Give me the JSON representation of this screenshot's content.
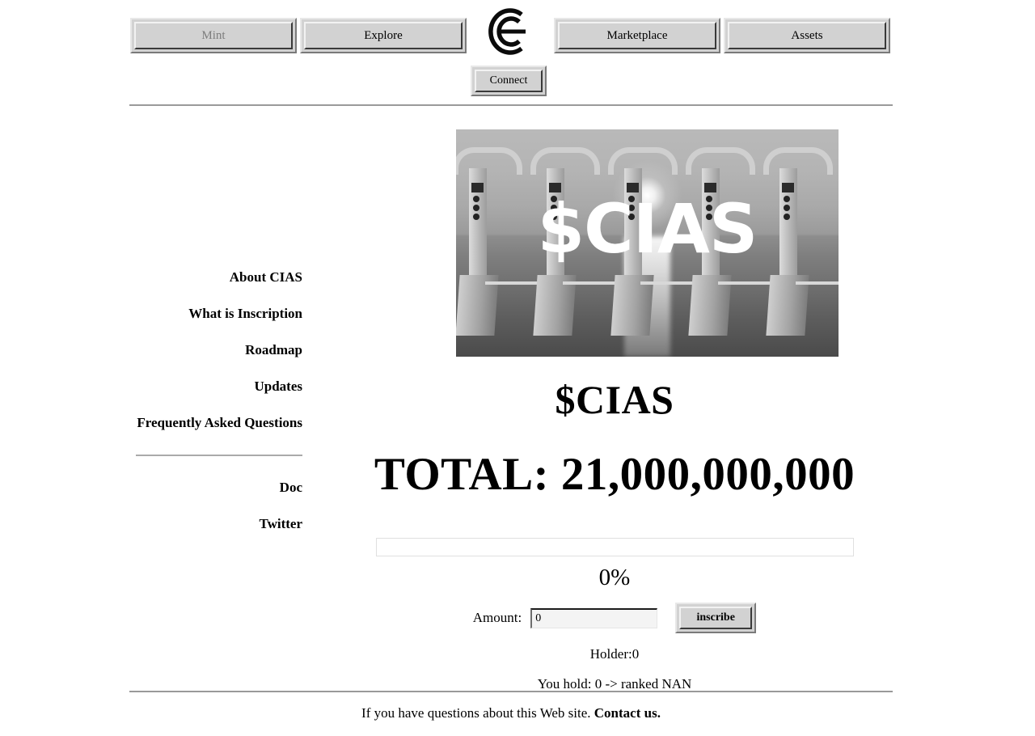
{
  "nav": {
    "left_buttons": [
      {
        "label": "Mint",
        "name": "mint",
        "disabled": true
      },
      {
        "label": "Explore",
        "name": "explore",
        "disabled": false
      }
    ],
    "right_buttons": [
      {
        "label": "Marketplace",
        "name": "marketplace",
        "disabled": false
      },
      {
        "label": "Assets",
        "name": "assets",
        "disabled": false
      }
    ],
    "logo_icon": "cias-monogram-icon",
    "connect_label": "Connect"
  },
  "sidebar": {
    "items": [
      {
        "label": "About CIAS"
      },
      {
        "label": "What is Inscription"
      },
      {
        "label": "Roadmap"
      },
      {
        "label": "Updates"
      },
      {
        "label": "Frequently Asked Questions"
      }
    ],
    "links": [
      {
        "label": "Doc"
      },
      {
        "label": "Twitter"
      }
    ]
  },
  "hero": {
    "overlay_text": "$CIAS",
    "alt": "grayscale photo of turnstile gantries standing in water at sunset"
  },
  "main": {
    "token_title": "$CIAS",
    "total_title": "TOTAL: 21,000,000,000",
    "progress_percent_label": "0%",
    "progress_percent_value": 0,
    "amount_label": "Amount:",
    "amount_value": "0",
    "amount_placeholder": "0",
    "inscribe_label": "inscribe",
    "holder_line": "Holder:0",
    "you_hold_line": "You hold: 0 -> ranked NAN"
  },
  "footer": {
    "text": "If you have questions about this Web site.",
    "contact_label": "Contact us."
  },
  "colors": {
    "page_background": "#ffffff",
    "button_face": "#d2d2d2",
    "button_highlight": "#f2f2f2",
    "button_shadow": "#3a3a3a",
    "disabled_text": "#7d7d7d",
    "rule": "#9a9a9a",
    "text": "#000000"
  }
}
